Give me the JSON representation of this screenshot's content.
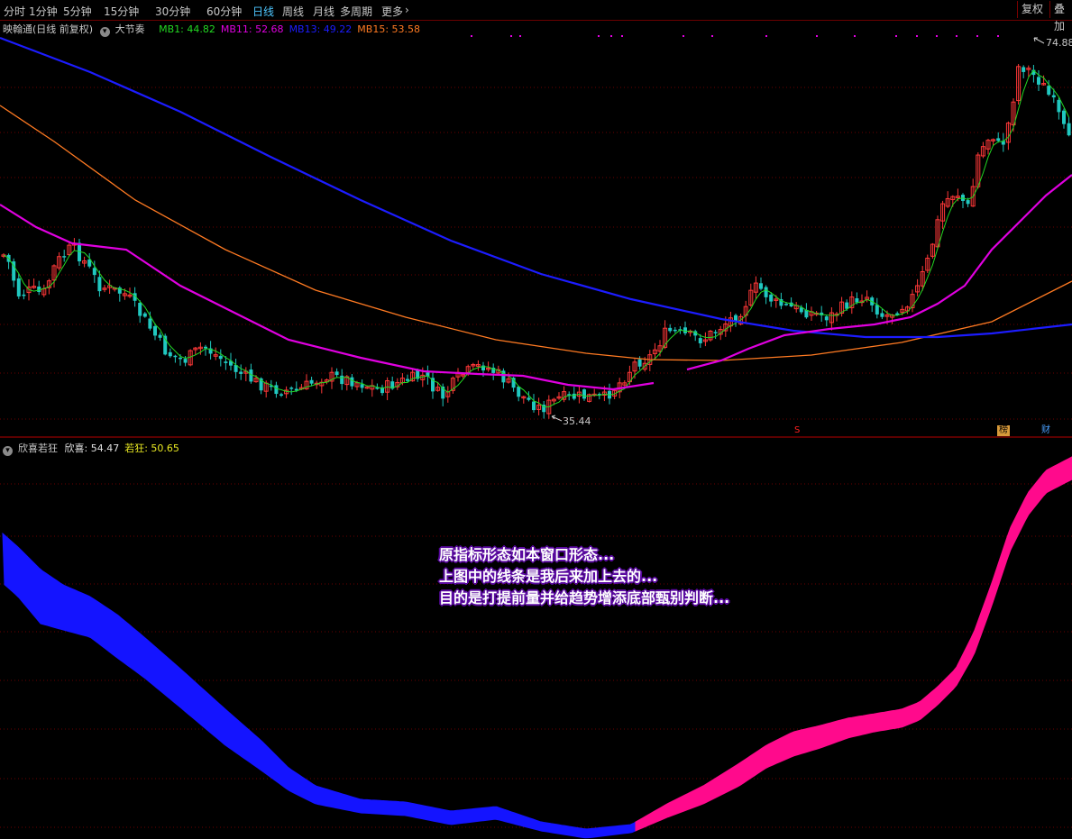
{
  "toolbar": {
    "periods": [
      "分时",
      "1分钟",
      "5分钟",
      "15分钟",
      "30分钟",
      "60分钟",
      "日线",
      "周线",
      "月线",
      "多周期",
      "更多"
    ],
    "active_period": "日线",
    "more_arrow": "›",
    "right_buttons": [
      "复权",
      "叠加"
    ]
  },
  "main_panel": {
    "stock_title": "映翰通(日线 前复权)",
    "indicator_name": "大节奏",
    "indicator_toggle_icon": "chevron-down-icon",
    "mb": [
      {
        "label": "MB1: 44.82",
        "color": "#22d822"
      },
      {
        "label": "MB11: 52.68",
        "color": "#e000e0"
      },
      {
        "label": "MB13: 49.22",
        "color": "#1c1cff"
      },
      {
        "label": "MB15: 53.58",
        "color": "#ff7a22"
      }
    ],
    "high_marker": "74.88",
    "low_marker": "35.44",
    "event_tags": [
      {
        "text": "S",
        "color": "#ff2020",
        "bg": "#000"
      },
      {
        "text": "榜",
        "color": "#000",
        "bg": "#d89a3a"
      },
      {
        "text": "财",
        "color": "#4aa0ff",
        "bg": "#000"
      }
    ]
  },
  "lower_panel": {
    "indicator_name": "欣喜若狂",
    "values": [
      {
        "label": "欣喜: 54.47",
        "color": "#e0e0e0"
      },
      {
        "label": "若狂: 50.65",
        "color": "#e8e822"
      }
    ]
  },
  "annotation": [
    "原指标形态如本窗口形态...",
    "上图中的线条是我后来加上去的...",
    "目的是打提前量并给趋势增添底部甄别判断..."
  ],
  "colors": {
    "up": "#ff3838",
    "down": "#20c8c0",
    "ma_short": "#22d822",
    "mb11": "#e000e0",
    "mb13": "#1c1cff",
    "mb15": "#ff7a22",
    "ribbon_down": "#1414ff",
    "ribbon_up": "#ff0a8c",
    "grid": "#6a0000"
  }
}
